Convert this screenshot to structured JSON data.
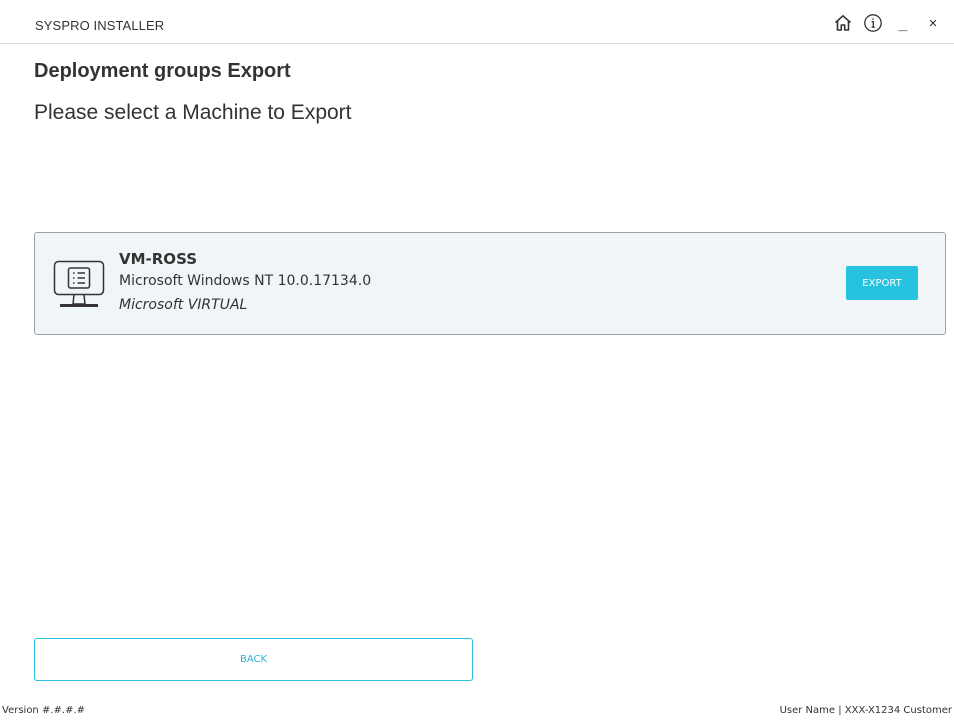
{
  "window": {
    "title": "SYSPRO INSTALLER",
    "controls": {
      "home_icon": "home-icon",
      "info_icon": "info-icon",
      "minimize_label": "_",
      "close_label": "×"
    }
  },
  "page": {
    "heading": "Deployment groups Export",
    "subheading": "Please select a Machine to Export"
  },
  "machines": [
    {
      "icon": "computer-icon",
      "name": "VM-ROSS",
      "os": "Microsoft Windows NT 10.0.17134.0",
      "type": "Microsoft VIRTUAL",
      "export_label": "EXPORT"
    }
  ],
  "actions": {
    "back_label": "BACK"
  },
  "footer": {
    "version": "Version #.#.#.#",
    "user": "User Name | XXX-X1234 Customer"
  },
  "colors": {
    "accent": "#27c2e0",
    "card_background": "#f0f5f7",
    "card_border": "#9aa3a8"
  }
}
